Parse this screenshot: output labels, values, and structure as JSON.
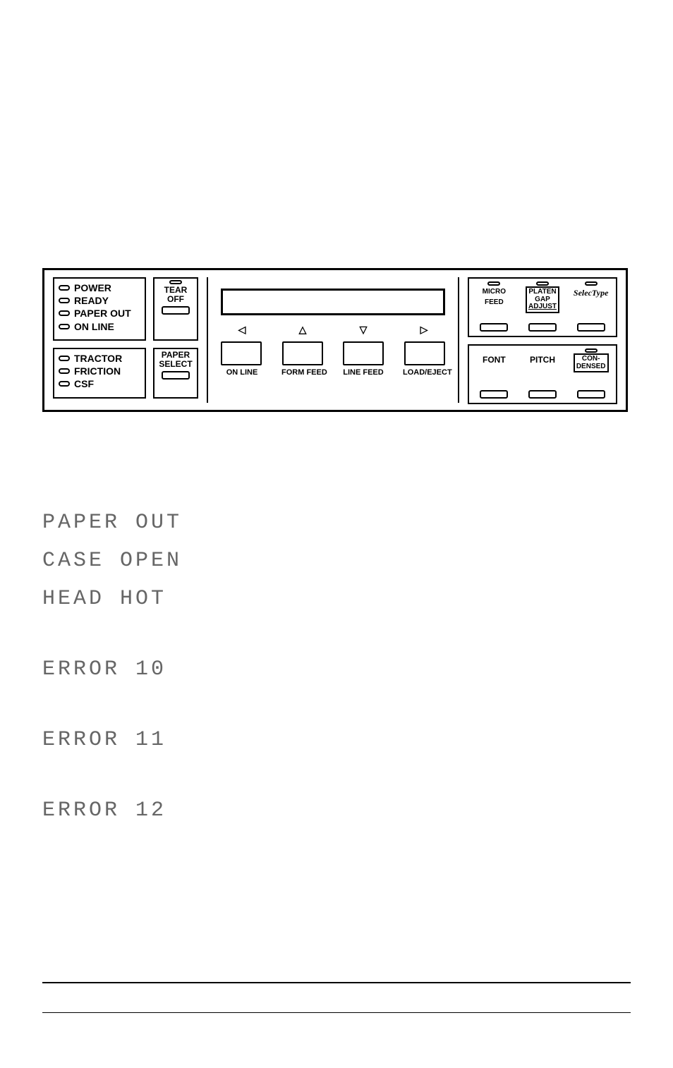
{
  "panel": {
    "status_top": [
      "POWER",
      "READY",
      "PAPER OUT",
      "ON LINE"
    ],
    "status_bottom": [
      "TRACTOR",
      "FRICTION",
      "CSF"
    ],
    "tear_off": {
      "line1": "TEAR",
      "line2": "OFF"
    },
    "paper_select": {
      "line1": "PAPER",
      "line2": "SELECT"
    },
    "arrows": [
      "◁",
      "△",
      "▽",
      "▷"
    ],
    "btn_labels": [
      "ON LINE",
      "FORM FEED",
      "LINE FEED",
      "LOAD/EJECT"
    ],
    "right_top": {
      "micro_feed": {
        "l1": "MICRO",
        "l2": "FEED"
      },
      "platen_gap": {
        "l1": "PLATEN",
        "l2": "GAP",
        "l3": "ADJUST"
      },
      "selectype": "SelecType"
    },
    "right_bottom": {
      "font": "FONT",
      "pitch": "PITCH",
      "condensed": {
        "l1": "CON-",
        "l2": "DENSED"
      }
    }
  },
  "messages": {
    "m1": "PAPER OUT",
    "m2": "CASE OPEN",
    "m3": "HEAD HOT",
    "m4": "ERROR 10",
    "m5": "ERROR 11",
    "m6": "ERROR 12"
  }
}
